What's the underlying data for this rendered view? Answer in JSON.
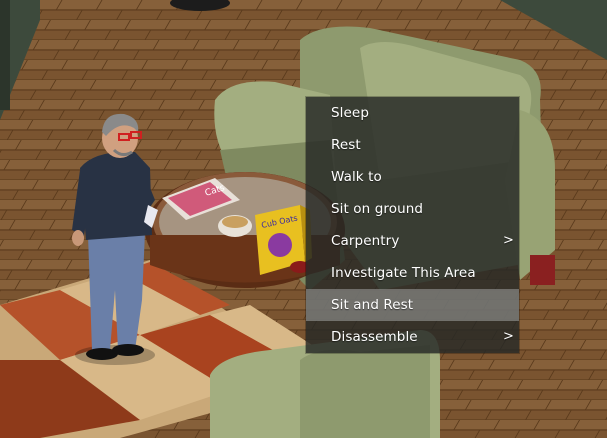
{
  "context_menu": {
    "items": [
      {
        "label": "Sleep",
        "has_submenu": false,
        "active": false
      },
      {
        "label": "Rest",
        "has_submenu": false,
        "active": false
      },
      {
        "label": "Walk to",
        "has_submenu": false,
        "active": false
      },
      {
        "label": "Sit on ground",
        "has_submenu": false,
        "active": false
      },
      {
        "label": "Carpentry",
        "has_submenu": true,
        "active": false
      },
      {
        "label": "Investigate This Area",
        "has_submenu": false,
        "active": false
      },
      {
        "label": "Sit and Rest",
        "has_submenu": false,
        "active": true
      },
      {
        "label": "Disassemble",
        "has_submenu": true,
        "active": false
      }
    ],
    "submenu_arrow": ">",
    "colors": {
      "menu_bg": "#262826",
      "highlight": "#969896",
      "text": "#ffffff"
    }
  },
  "scene": {
    "magazine_text": "Cats",
    "cereal_box_text": "Cub Oats",
    "icons": [
      "player-character",
      "sofa",
      "coffee-table",
      "cereal-box",
      "magazine",
      "bowl",
      "armchair",
      "checkered-rug",
      "wood-floor"
    ]
  }
}
